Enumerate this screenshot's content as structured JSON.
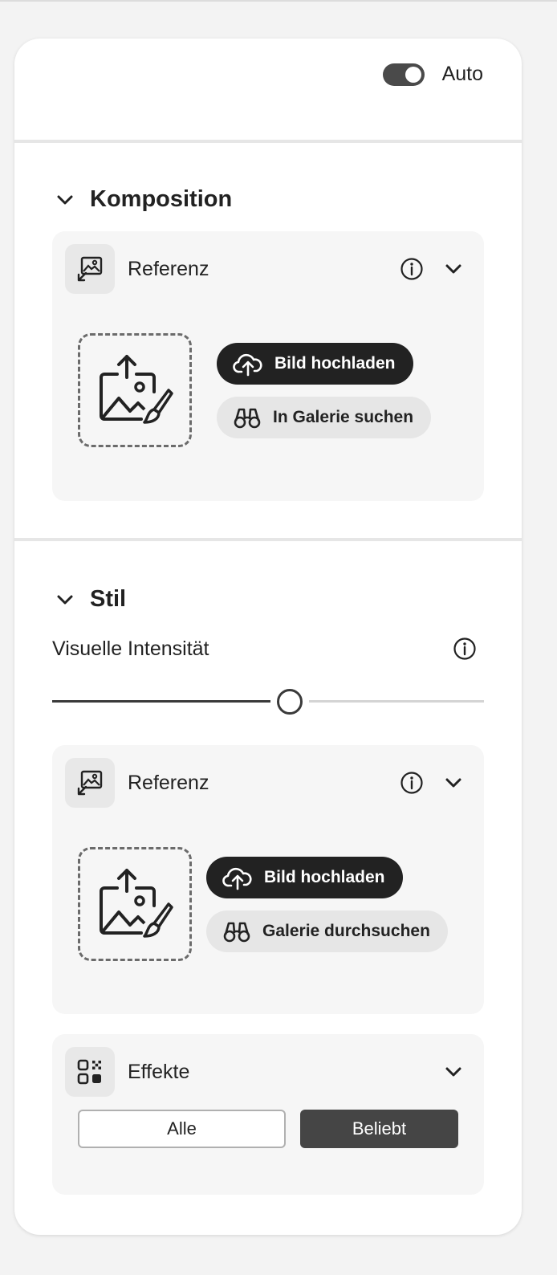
{
  "toggle": {
    "label": "Auto",
    "state": "on"
  },
  "composition": {
    "title": "Komposition",
    "reference": {
      "title": "Referenz",
      "upload_label": "Bild hochladen",
      "gallery_label": "In Galerie suchen"
    }
  },
  "style": {
    "title": "Stil",
    "intensity": {
      "label": "Visuelle Intensität",
      "value_fraction": 0.55
    },
    "reference": {
      "title": "Referenz",
      "upload_label": "Bild hochladen",
      "gallery_label": "Galerie durchsuchen"
    },
    "effects": {
      "title": "Effekte",
      "options": [
        "Alle",
        "Beliebt"
      ],
      "selected": "Beliebt"
    }
  },
  "icons": {
    "section_chevron": "chevron-down-icon",
    "reference": "image-reference-icon",
    "info": "info-icon",
    "upload_dropzone": "image-upload-icon",
    "upload_button": "cloud-upload-icon",
    "gallery_button": "binoculars-icon",
    "effects": "effects-grid-icon"
  },
  "colors": {
    "dark_button": "#222222",
    "light_button": "#e6e6e6",
    "card_bg": "#f6f6f6"
  }
}
